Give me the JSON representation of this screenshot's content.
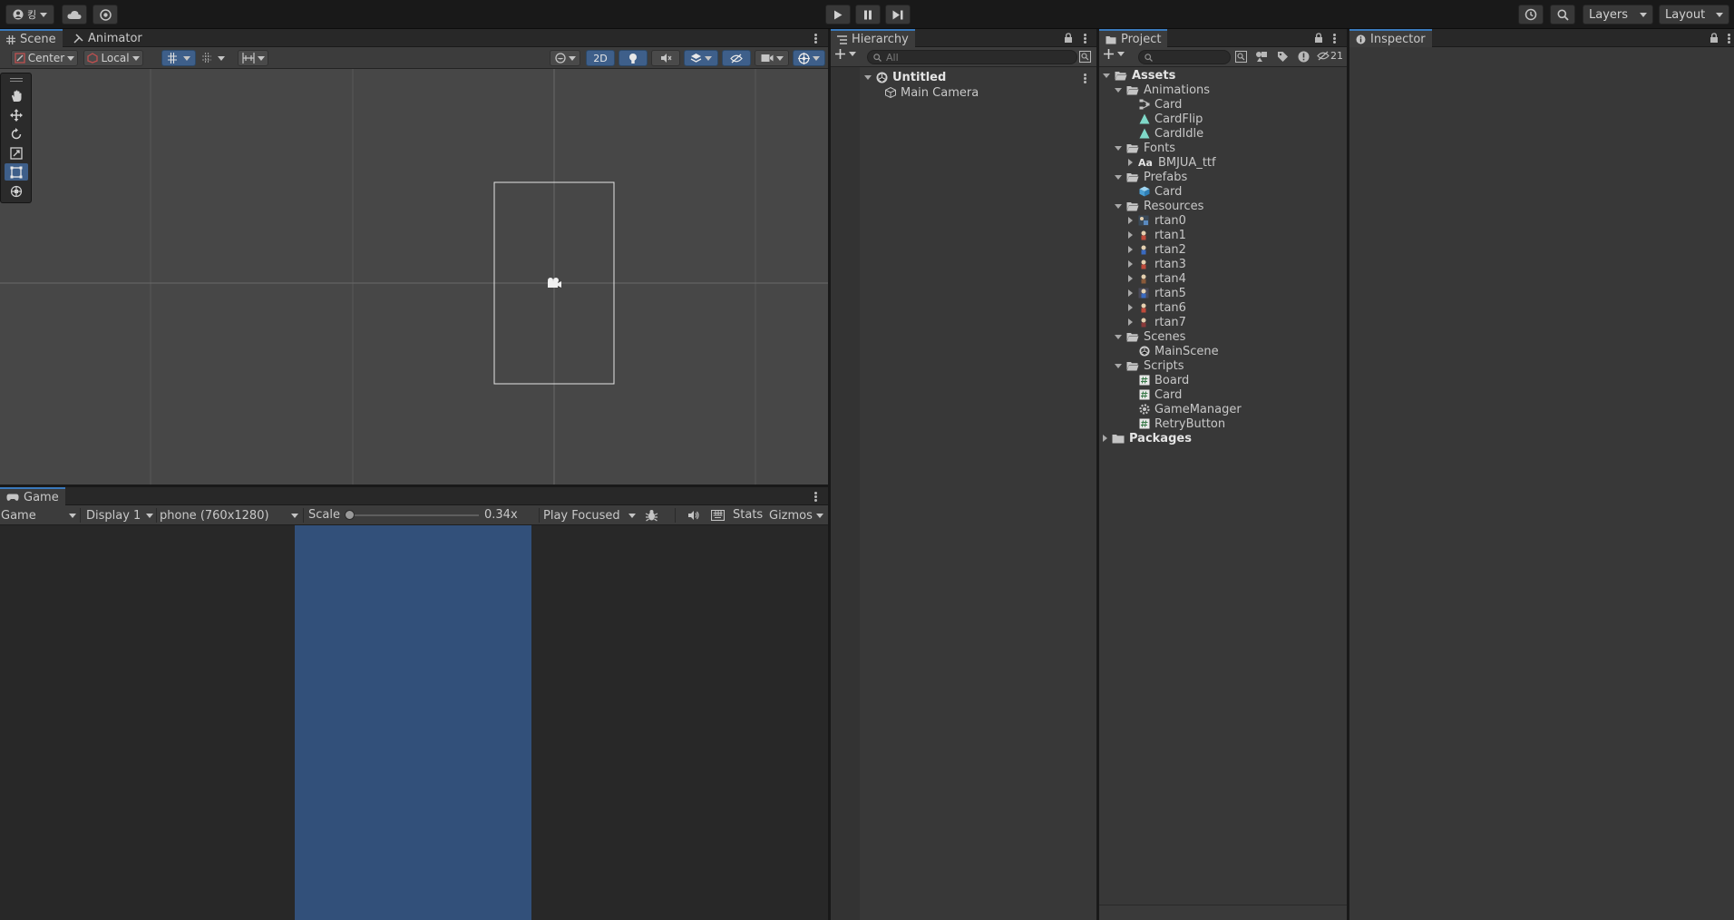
{
  "topbar": {
    "account_initial": "킹",
    "layers_label": "Layers",
    "layout_label": "Layout"
  },
  "scene_panel": {
    "tabs": [
      "Scene",
      "Animator"
    ],
    "pivot_label": "Center",
    "space_label": "Local",
    "mode_2d_label": "2D"
  },
  "game_panel": {
    "tab_label": "Game",
    "view_select": "Game",
    "display_select": "Display 1",
    "resolution_select": "phone (760x1280)",
    "scale_label": "Scale",
    "scale_value": "0.34x",
    "scale_fraction": 0.0,
    "play_mode_select": "Play Focused",
    "stats_label": "Stats",
    "gizmos_label": "Gizmos",
    "camera_bg_color": "#32507a"
  },
  "hierarchy": {
    "tab_label": "Hierarchy",
    "search_placeholder": "All",
    "scene_name": "Untitled",
    "items": [
      "Main Camera"
    ]
  },
  "project": {
    "tab_label": "Project",
    "hidden_count": "21",
    "assets_label": "Assets",
    "packages_label": "Packages",
    "folders": {
      "animations": {
        "label": "Animations",
        "items": [
          "Card",
          "CardFlip",
          "CardIdle"
        ]
      },
      "fonts": {
        "label": "Fonts",
        "items": [
          "BMJUA_ttf"
        ],
        "font_icon": "Aa"
      },
      "prefabs": {
        "label": "Prefabs",
        "items": [
          "Card"
        ]
      },
      "resources": {
        "label": "Resources",
        "items": [
          "rtan0",
          "rtan1",
          "rtan2",
          "rtan3",
          "rtan4",
          "rtan5",
          "rtan6",
          "rtan7"
        ]
      },
      "scenes": {
        "label": "Scenes",
        "items": [
          "MainScene"
        ]
      },
      "scripts": {
        "label": "Scripts",
        "items": [
          "Board",
          "Card",
          "GameManager",
          "RetryButton"
        ]
      }
    }
  },
  "inspector": {
    "tab_label": "Inspector"
  },
  "colors": {
    "accent": "#3a79bb",
    "panel_bg": "#383838",
    "scene_bg": "#474747"
  }
}
